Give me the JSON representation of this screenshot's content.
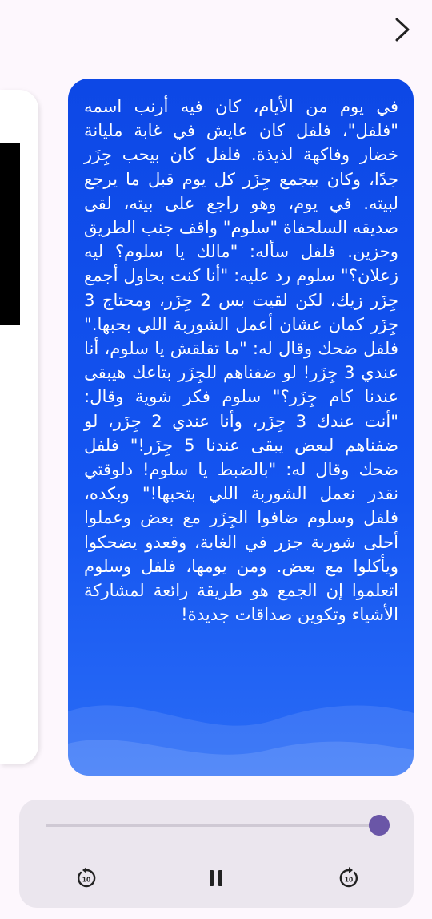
{
  "nav": {
    "next_icon": "chevron-right-icon"
  },
  "story": {
    "text": "في يوم من الأيام، كان فيه أرنب اسمه \"فلفل\"، فلفل كان عايش في غابة مليانة خضار وفاكهة لذيذة. فلفل كان بيحب جِزَر جدًا، وكان بيجمع جِزَر كل يوم قبل ما يرجع لبيته. في يوم، وهو راجع على بيته، لقى صديقه السلحفاة \"سلوم\" واقف جنب الطريق وحزين. فلفل سأله: \"مالك يا سلوم؟ ليه زعلان؟\" سلوم رد عليه: \"أنا كنت بحاول أجمع جِزَر زيك، لكن لقيت بس 2 جِزَر، ومحتاج 3 جِزَر كمان عشان أعمل الشوربة اللي بحبها.\" فلفل ضحك وقال له: \"ما تقلقش يا سلوم، أنا عندي 3 جِزَر! لو ضفناهم للجِزَر بتاعك هيبقى عندنا كام جِزَر؟\" سلوم فكر شوية وقال: \"أنت عندك 3 جِزَر، وأنا عندي 2 جِزَر، لو ضفناهم لبعض يبقى عندنا 5 جِزَر!\" فلفل ضحك وقال له: \"بالضبط يا سلوم! دلوقتي نقدر نعمل الشوربة اللي بتحبها!\" وبكده، فلفل وسلوم ضافوا الجِزَر مع بعض وعملوا أحلى شوربة جزر في الغابة، وقعدو يضحكوا ويأكلوا مع بعض. ومن يومها، فلفل وسلوم اتعلموا إن الجمع هو طريقة رائعة لمشاركة الأشياء وتكوين صداقات جديدة!"
  },
  "player": {
    "progress": 0.97,
    "rewind_label": "10",
    "forward_label": "10",
    "accent_color": "#6a56a7"
  },
  "colors": {
    "card_top": "#0d48e6",
    "card_bottom": "#2a6cf6",
    "page_bg": "#fdf7fd",
    "player_bg": "#ebe6ee"
  }
}
